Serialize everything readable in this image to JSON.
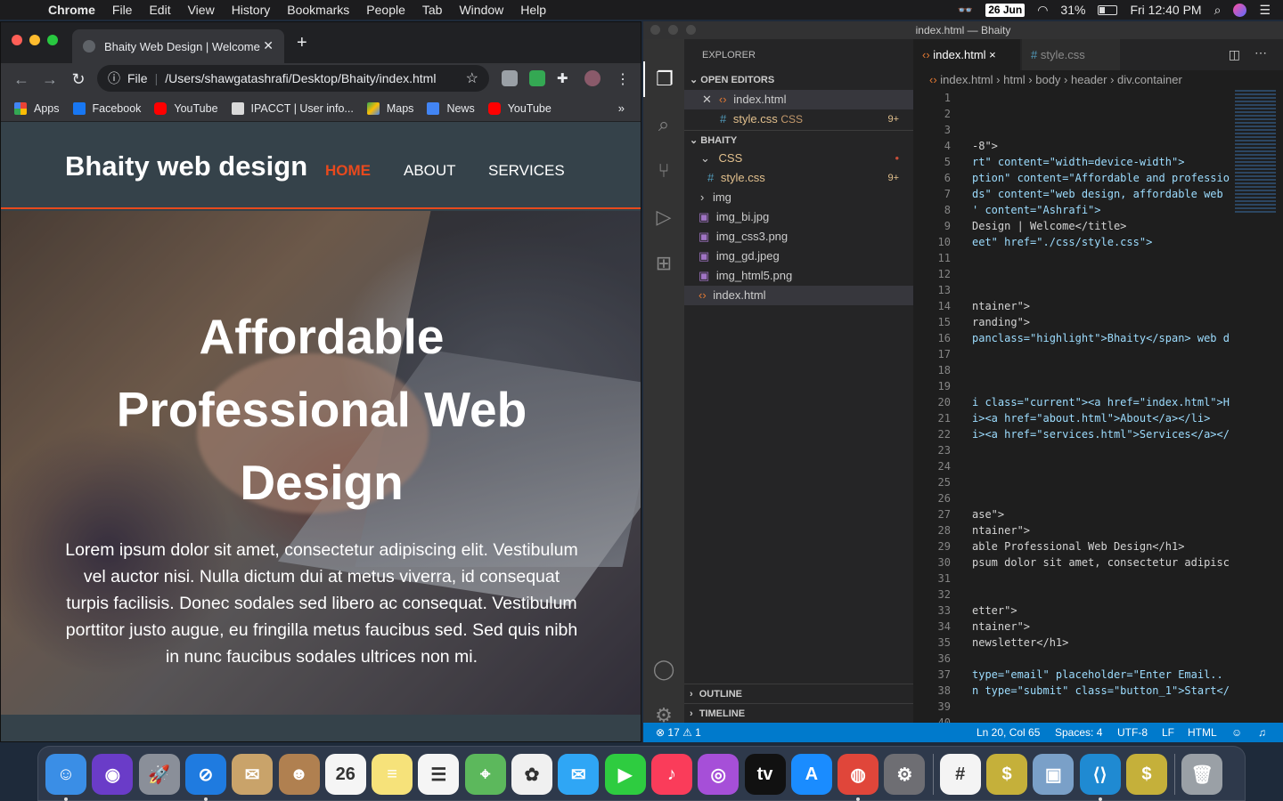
{
  "menubar": {
    "app": "Chrome",
    "items": [
      "File",
      "Edit",
      "View",
      "History",
      "Bookmarks",
      "People",
      "Tab",
      "Window",
      "Help"
    ],
    "date_badge": "26 Jun",
    "battery": "31%",
    "clock": "Fri 12:40 PM"
  },
  "chrome": {
    "tab_title": "Bhaity Web Design | Welcome",
    "url_scheme": "File",
    "url": "/Users/shawgatashrafi/Desktop/Bhaity/index.html",
    "bookmarks": [
      {
        "label": "Apps",
        "color": "#e8453c"
      },
      {
        "label": "Facebook",
        "color": "#1877f2"
      },
      {
        "label": "YouTube",
        "color": "#ff0000"
      },
      {
        "label": "IPACCT | User info...",
        "color": "#d9d9d9"
      },
      {
        "label": "Maps",
        "color": "#34a853"
      },
      {
        "label": "News",
        "color": "#4285f4"
      },
      {
        "label": "YouTube",
        "color": "#ff0000"
      }
    ],
    "bookmarks_more": "»"
  },
  "site": {
    "brand": "Bhaity web design",
    "nav": {
      "home": "HOME",
      "about": "ABOUT",
      "services": "SERVICES"
    },
    "accent": "#e8491d",
    "hero_title_lines": [
      "Affordable",
      "Professional Web",
      "Design"
    ],
    "hero_text": "Lorem ipsum dolor sit amet, consectetur adipiscing elit. Vestibulum vel auctor nisi. Nulla dictum dui at metus viverra, id consequat turpis facilisis. Donec sodales sed libero ac consequat. Vestibulum porttitor justo augue, eu fringilla metus faucibus sed. Sed quis nibh in nunc faucibus sodales ultrices non mi."
  },
  "vscode": {
    "window_title": "index.html — Bhaity",
    "explorer_title": "EXPLORER",
    "open_editors": "OPEN EDITORS",
    "open_files": [
      {
        "name": "index.html",
        "extra": "",
        "badge": ""
      },
      {
        "name": "style.css",
        "extra": "CSS",
        "badge": "9+"
      }
    ],
    "project": "BHAITY",
    "tree": [
      {
        "name": "CSS",
        "kind": "folder-open",
        "badge": "•"
      },
      {
        "name": "style.css",
        "kind": "css",
        "badge": "9+"
      },
      {
        "name": "img",
        "kind": "folder",
        "badge": ""
      },
      {
        "name": "img_bi.jpg",
        "kind": "image",
        "badge": ""
      },
      {
        "name": "img_css3.png",
        "kind": "image",
        "badge": ""
      },
      {
        "name": "img_gd.jpeg",
        "kind": "image",
        "badge": ""
      },
      {
        "name": "img_html5.png",
        "kind": "image",
        "badge": ""
      },
      {
        "name": "index.html",
        "kind": "html",
        "badge": ""
      }
    ],
    "outline": "OUTLINE",
    "timeline": "TIMELINE",
    "tabs": [
      {
        "name": "index.html",
        "close": "×"
      },
      {
        "name": "style.css",
        "close": ""
      }
    ],
    "breadcrumbs": [
      "index.html",
      "html",
      "body",
      "header",
      "div.container"
    ],
    "code_lines": [
      {
        "n": "1",
        "t": ""
      },
      {
        "n": "2",
        "t": ""
      },
      {
        "n": "3",
        "t": ""
      },
      {
        "n": "4",
        "t": "-8\">"
      },
      {
        "n": "5",
        "t": "rt\" content=\"width=device-width\">"
      },
      {
        "n": "6",
        "t": "ption\" content=\"Affordable and professio"
      },
      {
        "n": "7",
        "t": "ds\" content=\"web design, affordable web"
      },
      {
        "n": "8",
        "t": "' content=\"Ashrafi\">"
      },
      {
        "n": "9",
        "t": "Design | Welcome</title>"
      },
      {
        "n": "10",
        "t": "eet\" href=\"./css/style.css\">"
      },
      {
        "n": "11",
        "t": ""
      },
      {
        "n": "12",
        "t": ""
      },
      {
        "n": "13",
        "t": ""
      },
      {
        "n": "14",
        "t": "ntainer\">"
      },
      {
        "n": "15",
        "t": "randing\">"
      },
      {
        "n": "16",
        "t": "panclass=\"highlight\">Bhaity</span> web d"
      },
      {
        "n": "17",
        "t": ""
      },
      {
        "n": "18",
        "t": ""
      },
      {
        "n": "19",
        "t": ""
      },
      {
        "n": "20",
        "t": "i class=\"current\"><a href=\"index.html\">H"
      },
      {
        "n": "21",
        "t": "i><a href=\"about.html\">About</a></li>"
      },
      {
        "n": "22",
        "t": "i><a href=\"services.html\">Services</a></"
      },
      {
        "n": "23",
        "t": ""
      },
      {
        "n": "24",
        "t": ""
      },
      {
        "n": "25",
        "t": ""
      },
      {
        "n": "26",
        "t": ""
      },
      {
        "n": "27",
        "t": "ase\">"
      },
      {
        "n": "28",
        "t": "ntainer\">"
      },
      {
        "n": "29",
        "t": "able Professional Web Design</h1>"
      },
      {
        "n": "30",
        "t": "psum dolor sit amet, consectetur adipisc"
      },
      {
        "n": "31",
        "t": ""
      },
      {
        "n": "32",
        "t": ""
      },
      {
        "n": "33",
        "t": "etter\">"
      },
      {
        "n": "34",
        "t": "ntainer\">"
      },
      {
        "n": "35",
        "t": "newsletter</h1>"
      },
      {
        "n": "36",
        "t": ""
      },
      {
        "n": "37",
        "t": " type=\"email\" placeholder=\"Enter Email.."
      },
      {
        "n": "38",
        "t": "n type=\"submit\" class=\"button_1\">Start</"
      },
      {
        "n": "39",
        "t": ""
      },
      {
        "n": "40",
        "t": ""
      }
    ],
    "status": {
      "problems": "⊗ 17 ⚠ 1",
      "position": "Ln 20, Col 65",
      "spaces": "Spaces: 4",
      "encoding": "UTF-8",
      "eol": "LF",
      "language": "HTML"
    }
  },
  "dock": [
    {
      "name": "finder",
      "glyph": "☺",
      "color": "#3a8ee6"
    },
    {
      "name": "siri",
      "glyph": "◉",
      "color": "#6a3cc8"
    },
    {
      "name": "launchpad",
      "glyph": "🚀",
      "color": "#8a8f99"
    },
    {
      "name": "safari",
      "glyph": "⊘",
      "color": "#1f7be0"
    },
    {
      "name": "mail-stamp",
      "glyph": "✉",
      "color": "#c9a36a"
    },
    {
      "name": "contacts",
      "glyph": "☻",
      "color": "#b08050"
    },
    {
      "name": "calendar",
      "glyph": "26",
      "color": "#f5f5f5"
    },
    {
      "name": "notes",
      "glyph": "≡",
      "color": "#f6e27a"
    },
    {
      "name": "reminders",
      "glyph": "☰",
      "color": "#f5f5f5"
    },
    {
      "name": "maps",
      "glyph": "⌖",
      "color": "#5cb85c"
    },
    {
      "name": "photos",
      "glyph": "✿",
      "color": "#f0f0f0"
    },
    {
      "name": "messages",
      "glyph": "✉",
      "color": "#2fa6f5"
    },
    {
      "name": "facetime",
      "glyph": "▶",
      "color": "#2ecc40"
    },
    {
      "name": "music",
      "glyph": "♪",
      "color": "#fa3c5a"
    },
    {
      "name": "podcasts",
      "glyph": "◎",
      "color": "#a64fd8"
    },
    {
      "name": "apple-tv",
      "glyph": "tv",
      "color": "#111111"
    },
    {
      "name": "app-store",
      "glyph": "A",
      "color": "#1a8cff"
    },
    {
      "name": "chrome",
      "glyph": "◍",
      "color": "#e0463a"
    },
    {
      "name": "system-preferences",
      "glyph": "⚙",
      "color": "#6e6e73"
    },
    {
      "name": "slack",
      "glyph": "#",
      "color": "#f4f4f4"
    },
    {
      "name": "money-app",
      "glyph": "$",
      "color": "#c5b03a"
    },
    {
      "name": "preview",
      "glyph": "▣",
      "color": "#7aa0c8"
    },
    {
      "name": "vscode",
      "glyph": "⟨⟩",
      "color": "#1f8ad2"
    },
    {
      "name": "money-folder",
      "glyph": "$",
      "color": "#c5b03a"
    },
    {
      "name": "trash",
      "glyph": "🗑",
      "color": "#9aa0a6"
    }
  ]
}
